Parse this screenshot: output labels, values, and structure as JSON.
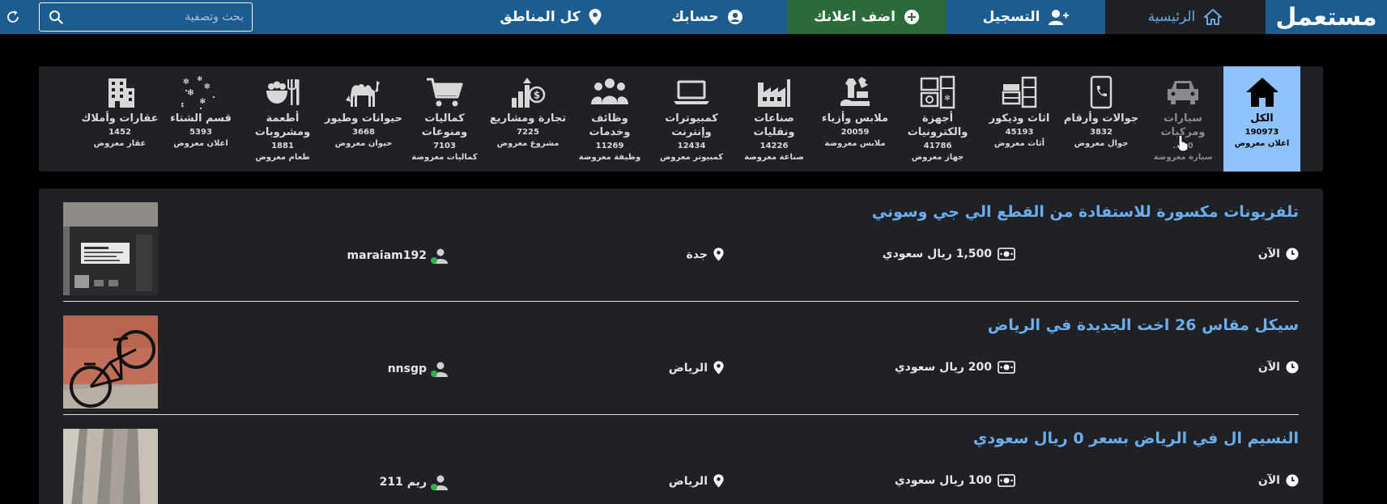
{
  "header": {
    "logo": "مستعمل",
    "nav": {
      "home": "الرئيسية",
      "register": "التسجيل",
      "post_ad": "اضف اعلانك",
      "account": "حسابك",
      "areas": "كل المناطق"
    },
    "search": {
      "placeholder": "بحث وتصفية",
      "value": ""
    },
    "colors": {
      "bar": "#1c5c90",
      "home_bg": "#1f2125",
      "post_bg": "#2a6b39",
      "accent": "#6aa9e5"
    }
  },
  "categories": [
    {
      "name": "الكل",
      "count": "190973",
      "sub": "اعلان معروض",
      "icon": "home-icon"
    },
    {
      "name": "سيارات ومركبات",
      "count": "20...",
      "sub": "سيارة معروضة",
      "icon": "car-icon"
    },
    {
      "name": "جوالات وأرقام",
      "count": "3832",
      "sub": "جوال معروض",
      "icon": "phone-icon"
    },
    {
      "name": "اثاث وديكور",
      "count": "45193",
      "sub": "أثاث معروض",
      "icon": "furniture-icon"
    },
    {
      "name": "أجهزة والكترونيات",
      "count": "41786",
      "sub": "جهاز معروض",
      "icon": "appliances-icon"
    },
    {
      "name": "ملابس وأزياء",
      "count": "20059",
      "sub": "ملابس معروضة",
      "icon": "clothes-icon"
    },
    {
      "name": "صناعات ونقليات",
      "count": "14226",
      "sub": "صناعة معروضة",
      "icon": "factory-icon"
    },
    {
      "name": "كمبيوترات وإنترنت",
      "count": "12434",
      "sub": "كمبيوتر معروض",
      "icon": "laptop-icon"
    },
    {
      "name": "وظائف وخدمات",
      "count": "11269",
      "sub": "وظيفة معروضة",
      "icon": "people-icon"
    },
    {
      "name": "تجارة ومشاريع",
      "count": "7225",
      "sub": "مشروع معروض",
      "icon": "business-icon"
    },
    {
      "name": "كماليات ومنوعات",
      "count": "7103",
      "sub": "كماليات معروضة",
      "icon": "cart-icon"
    },
    {
      "name": "حيوانات وطيور",
      "count": "3668",
      "sub": "حيوان معروض",
      "icon": "camel-icon"
    },
    {
      "name": "أطعمة ومشروبات",
      "count": "1881",
      "sub": "طعام معروض",
      "icon": "food-icon"
    },
    {
      "name": "قسم الشتاء",
      "count": "5393",
      "sub": "اعلان معروض",
      "icon": "snow-icon"
    },
    {
      "name": "عقارات وأملاك",
      "count": "1452",
      "sub": "عقار معروض",
      "icon": "building-icon"
    }
  ],
  "listings": [
    {
      "title": "تلفزيونات مكسورة للاستفادة من القطع الي جي وسوني",
      "time": "الآن",
      "price": "1,500 ريال سعودي",
      "location": "جدة",
      "user": "maraiam192"
    },
    {
      "title": "سيكل مقاس 26 اخت الجديدة في الرياض",
      "time": "الآن",
      "price": "200 ريال سعودي",
      "location": "الرياض",
      "user": "nnsgp"
    },
    {
      "title": "النسيم ال في الرياض بسعر 0 ريال سعودي",
      "time": "الآن",
      "price": "100 ريال سعودي",
      "location": "الرياض",
      "user": "ريم 211"
    }
  ]
}
